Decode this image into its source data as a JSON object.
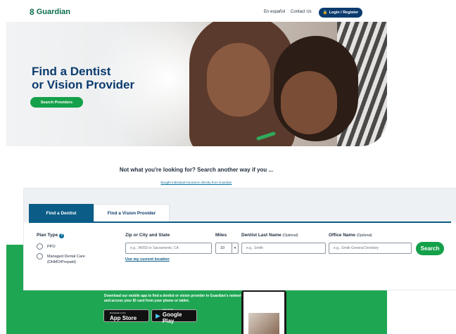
{
  "header": {
    "logo_text": "Guardian",
    "nav_espanol": "En español",
    "nav_contact": "Contact Us",
    "login_label": "Login / Register"
  },
  "hero": {
    "title_line1": "Find a Dentist",
    "title_line2": "or Vision Provider",
    "button_label": "Search Providers"
  },
  "alt_search": {
    "heading": "Not what you're looking for? Search another way if you ...",
    "link": "Bought Individual Insurance directly from Guardian"
  },
  "search_panel": {
    "tabs": [
      {
        "label": "Find a Dentist",
        "active": true
      },
      {
        "label": "Find a Vision Provider",
        "active": false
      }
    ],
    "plan_type_label": "Plan Type",
    "plan_options": [
      {
        "label": "PPO"
      },
      {
        "label": "Managed Dental Care (DHMO/Prepaid)"
      }
    ],
    "zip_label": "Zip or City and State",
    "zip_placeholder": "e.g., 94203 or Sacramento, CA",
    "use_location": "Use my current location",
    "miles_label": "Miles",
    "miles_value": "10",
    "dentist_label": "Dentist Last Name",
    "dentist_optional": "(Optional)",
    "dentist_placeholder": "e.g., Smith",
    "office_label": "Office Name",
    "office_optional": "(Optional)",
    "office_placeholder": "e.g., Smile General Dentistry",
    "search_button": "Search"
  },
  "app_promo": {
    "text": "Download our mobile app to find a dentist or vision provider in Guardian's networks and access your ID card from your phone or tablet.",
    "apple_small": "Download on the",
    "apple_big": "App Store",
    "google_small": "GET IT ON",
    "google_big": "Google Play"
  },
  "colors": {
    "brand_green": "#15a04a",
    "brand_navy": "#0b3b6e",
    "tab_active": "#0b5d87"
  }
}
